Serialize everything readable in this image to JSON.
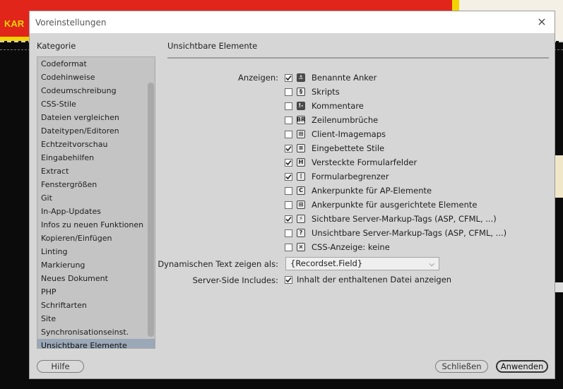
{
  "background": {
    "banner_text": "KAR"
  },
  "dialog": {
    "title": "Voreinstellungen",
    "close_glyph": "×",
    "category_label": "Kategorie",
    "categories": [
      "Codeformat",
      "Codehinweise",
      "Codeumschreibung",
      "CSS-Stile",
      "Dateien vergleichen",
      "Dateitypen/Editoren",
      "Echtzeitvorschau",
      "Eingabehilfen",
      "Extract",
      "Fenstergrößen",
      "Git",
      "In-App-Updates",
      "Infos zu neuen Funktionen",
      "Kopieren/Einfügen",
      "Linting",
      "Markierung",
      "Neues Dokument",
      "PHP",
      "Schriftarten",
      "Site",
      "Synchronisationseinst.",
      "Unsichtbare Elemente"
    ],
    "selected_category": "Unsichtbare Elemente",
    "section_title": "Unsichtbare Elemente",
    "show_label": "Anzeigen:",
    "options": [
      {
        "label": "Benannte Anker",
        "checked": true,
        "icon": "anchor-icon",
        "glyph": "⚓"
      },
      {
        "label": "Skripts",
        "checked": false,
        "icon": "script-icon",
        "glyph": "§"
      },
      {
        "label": "Kommentare",
        "checked": false,
        "icon": "comment-icon",
        "glyph": "!-"
      },
      {
        "label": "Zeilenumbrüche",
        "checked": false,
        "icon": "line-break-icon",
        "glyph": "BR"
      },
      {
        "label": "Client-Imagemaps",
        "checked": false,
        "icon": "imagemap-icon",
        "glyph": "⊞"
      },
      {
        "label": "Eingebettete Stile",
        "checked": true,
        "icon": "embedded-style-icon",
        "glyph": "≡"
      },
      {
        "label": "Versteckte Formularfelder",
        "checked": true,
        "icon": "hidden-field-icon",
        "glyph": "H"
      },
      {
        "label": "Formularbegrenzer",
        "checked": true,
        "icon": "form-delimiter-icon",
        "glyph": "⋮"
      },
      {
        "label": "Ankerpunkte für AP-Elemente",
        "checked": false,
        "icon": "ap-anchor-icon",
        "glyph": "C"
      },
      {
        "label": "Ankerpunkte für ausgerichtete Elemente",
        "checked": false,
        "icon": "aligned-anchor-icon",
        "glyph": "⊞"
      },
      {
        "label": "Sichtbare Server-Markup-Tags (ASP, CFML, ...)",
        "checked": true,
        "icon": "visible-server-tag-icon",
        "glyph": "⚡"
      },
      {
        "label": "Unsichtbare Server-Markup-Tags (ASP, CFML, ...)",
        "checked": false,
        "icon": "invisible-server-tag-icon",
        "glyph": "?"
      },
      {
        "label": "CSS-Anzeige: keine",
        "checked": false,
        "icon": "css-display-none-icon",
        "glyph": "×"
      }
    ],
    "dynamic_text_label": "Dynamischen Text zeigen als:",
    "dynamic_text_value": "{Recordset.Field}",
    "ssi_label": "Server-Side Includes:",
    "ssi_option": {
      "label": "Inhalt der enthaltenen Datei anzeigen",
      "checked": true
    },
    "buttons": {
      "help": "Hilfe",
      "close": "Schließen",
      "apply": "Anwenden"
    }
  }
}
